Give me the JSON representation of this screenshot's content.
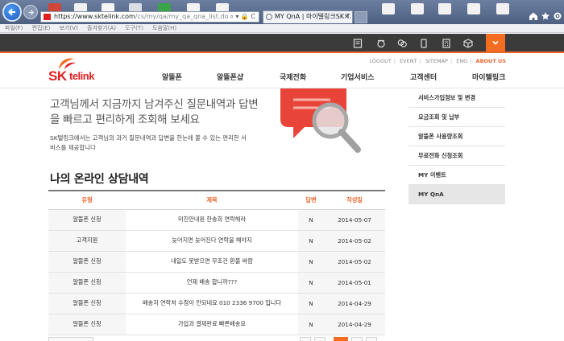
{
  "browser": {
    "url_main": "https://www.sktelink.com",
    "url_rest": "/cs/my/qa/my_qa_qna_list.do",
    "addr_tools": "⌕ ▾ 🔒 C",
    "tab_title": "MY QnA | 마이텔링크SK T...",
    "tab_close": "×",
    "menu": [
      "파일(F)",
      "편집(E)",
      "보기(V)",
      "즐겨찾기(A)",
      "도구(T)",
      "도움말(H)"
    ]
  },
  "header": {
    "util_links": [
      "LOGOUT",
      "EVENT",
      "SITEMAP",
      "ENG"
    ],
    "about": "ABOUT US",
    "logo_sk": "SK",
    "logo_telink": "telink",
    "nav": [
      "알뜰폰",
      "알뜰폰샵",
      "국제전화",
      "기업서비스",
      "고객센터",
      "마이텔링크"
    ]
  },
  "intro": {
    "headline": "고객님께서 지금까지 남겨주신 질문내역과 답변을 빠르고 편리하게 조회해 보세요",
    "desc": "SK텔링크에서는 고객님의 과거 질문내역과 답변을 한눈에 볼 수 있는 편리한 서비스를 제공합니다"
  },
  "section_title": "나의 온라인 상담내역",
  "table": {
    "headers": [
      "유형",
      "제목",
      "답변",
      "작성일"
    ],
    "rows": [
      {
        "type": "알뜰폰 신청",
        "title": "미친안내원 한송희 연락해라",
        "answer": "N",
        "date": "2014-05-07"
      },
      {
        "type": "고객지원",
        "title": "늦어지면 늦어진다 연락을 해야지",
        "answer": "N",
        "date": "2014-05-02"
      },
      {
        "type": "알뜰폰 신청",
        "title": "내일도 못받으면 무조건 환불 바람",
        "answer": "N",
        "date": "2014-05-02"
      },
      {
        "type": "알뜰폰 신청",
        "title": "언제 배송 합니까???",
        "answer": "N",
        "date": "2014-05-01"
      },
      {
        "type": "알뜰폰 신청",
        "title": "배송지 연락처 수정이 안되네요 010 2336 9700 입니다",
        "answer": "N",
        "date": "2014-04-29"
      },
      {
        "type": "알뜰폰 신청",
        "title": "가입과 결제완료 빠른배송요",
        "answer": "N",
        "date": "2014-04-29"
      }
    ]
  },
  "side_nav": {
    "items": [
      "서비스가입정보 및 변경",
      "요금조회 및 납부",
      "알뜰폰 사용량조회",
      "무료전화 신청조회",
      "MY 이벤트",
      "MY QnA"
    ],
    "active_index": 5
  },
  "colors": {
    "accent": "#f26d21",
    "brand_red": "#e02020",
    "toolbar_bg": "#3b3b3b"
  }
}
